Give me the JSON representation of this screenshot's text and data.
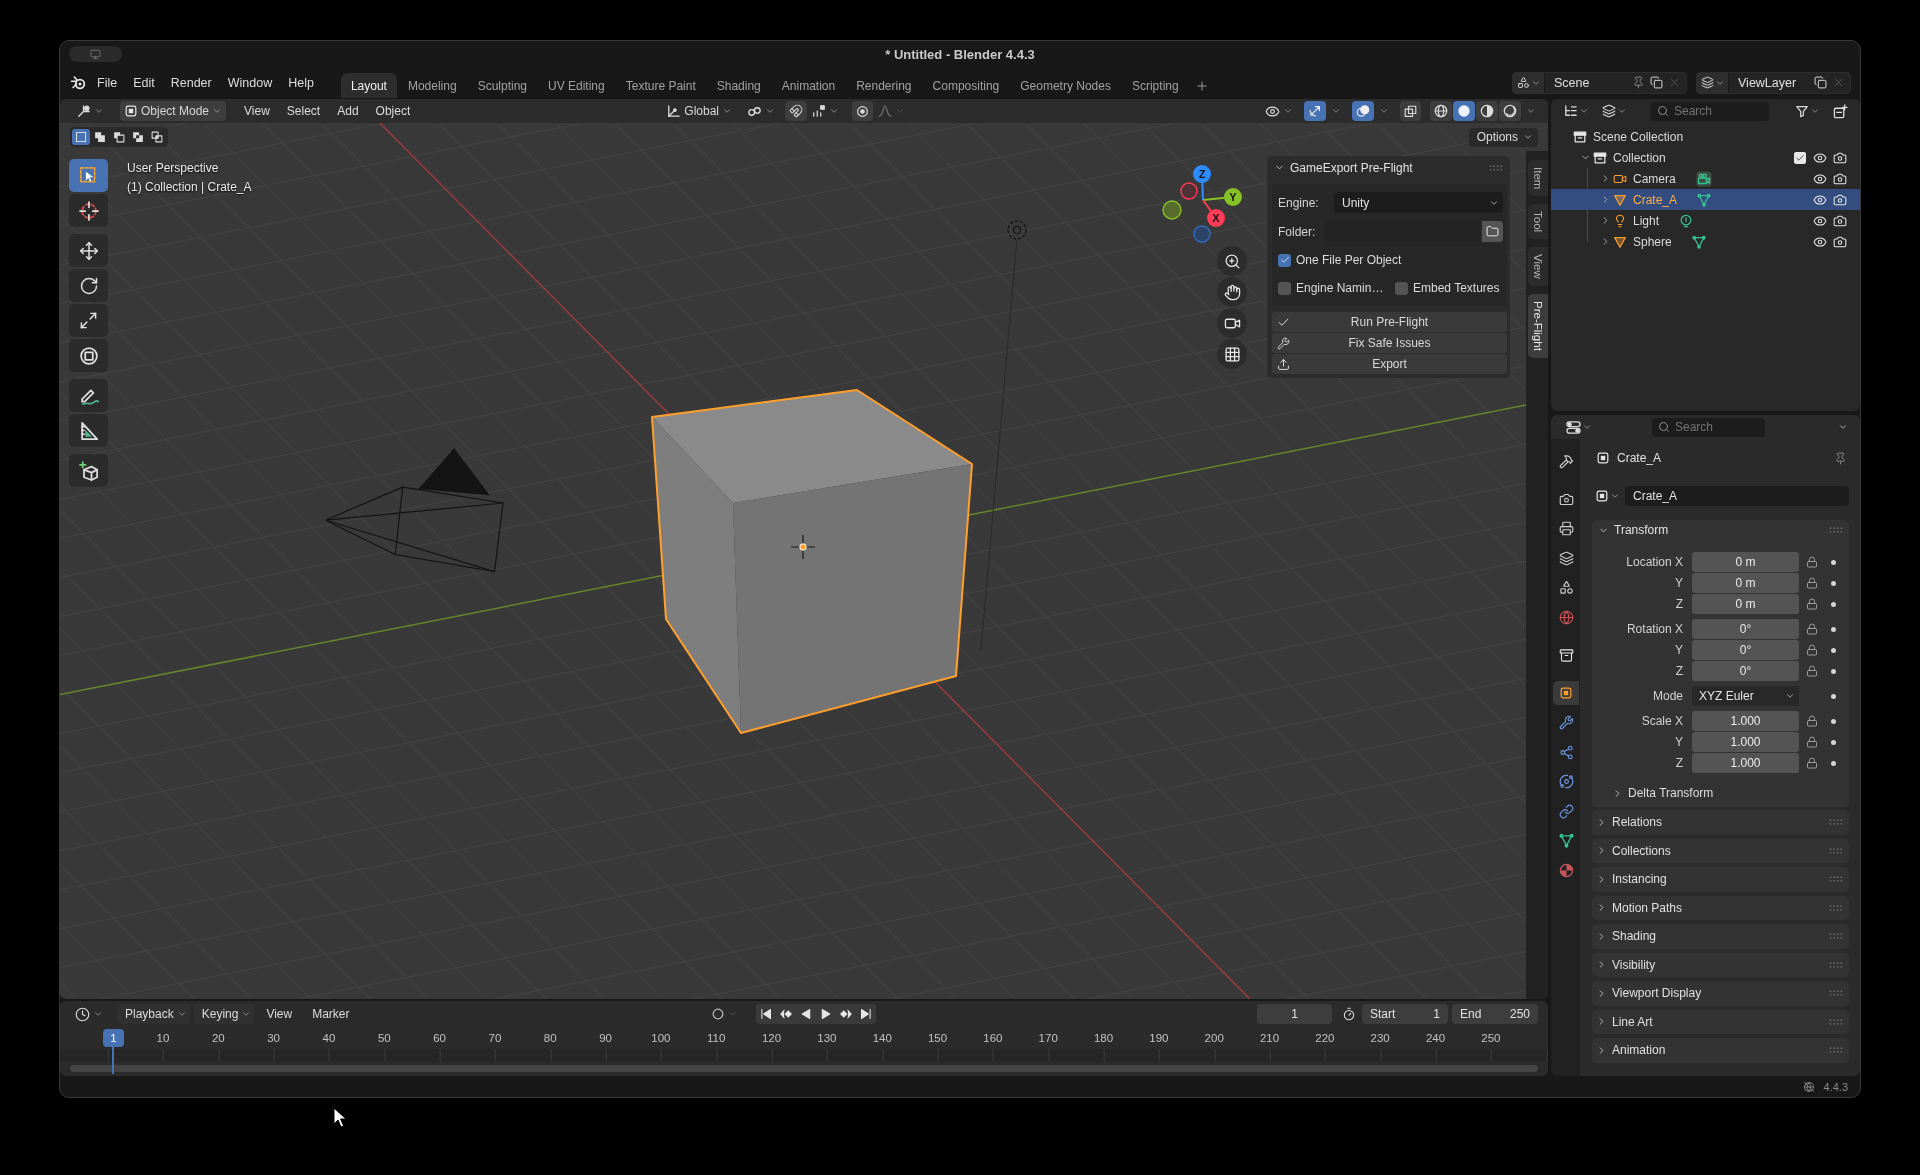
{
  "window": {
    "title": "* Untitled - Blender 4.4.3"
  },
  "menus": [
    "File",
    "Edit",
    "Render",
    "Window",
    "Help"
  ],
  "workspace_tabs": [
    {
      "label": "Layout",
      "selected": true
    },
    {
      "label": "Modeling",
      "selected": false
    },
    {
      "label": "Sculpting",
      "selected": false
    },
    {
      "label": "UV Editing",
      "selected": false
    },
    {
      "label": "Texture Paint",
      "selected": false
    },
    {
      "label": "Shading",
      "selected": false
    },
    {
      "label": "Animation",
      "selected": false
    },
    {
      "label": "Rendering",
      "selected": false
    },
    {
      "label": "Compositing",
      "selected": false
    },
    {
      "label": "Geometry Nodes",
      "selected": false
    },
    {
      "label": "Scripting",
      "selected": false
    }
  ],
  "scene_selector": {
    "value": "Scene"
  },
  "view_layer_selector": {
    "value": "ViewLayer"
  },
  "viewport": {
    "header": {
      "mode": "Object Mode",
      "menus": [
        "View",
        "Select",
        "Add",
        "Object"
      ],
      "orientation": "Global",
      "snap": {
        "on": false
      },
      "proportional_editing": {
        "on": false
      },
      "gizmos": {
        "on": true
      },
      "overlays": {
        "on": true
      },
      "xray": {
        "on": false
      },
      "shading": [
        {
          "kind": "wireframe",
          "selected": false
        },
        {
          "kind": "solid",
          "selected": true
        },
        {
          "kind": "material",
          "selected": false
        },
        {
          "kind": "rendered",
          "selected": false
        }
      ]
    },
    "select_modes": [
      {
        "kind": "set",
        "selected": true
      },
      {
        "kind": "extend",
        "selected": false
      },
      {
        "kind": "subtract",
        "selected": false
      },
      {
        "kind": "invert",
        "selected": false
      },
      {
        "kind": "intersect",
        "selected": false
      }
    ],
    "options": "Options",
    "tool_groups": [
      [
        {
          "kind": "select_box",
          "selected": true
        },
        {
          "kind": "cursor",
          "selected": false
        }
      ],
      [
        {
          "kind": "move",
          "selected": false
        },
        {
          "kind": "rotate",
          "selected": false
        },
        {
          "kind": "scale",
          "selected": false
        },
        {
          "kind": "transform",
          "selected": false
        }
      ],
      [
        {
          "kind": "annotate",
          "selected": false
        },
        {
          "kind": "measure",
          "selected": false
        }
      ],
      [
        {
          "kind": "add_cube",
          "selected": false
        }
      ]
    ],
    "info": [
      "User Perspective",
      "(1) Collection | Crate_A"
    ],
    "scene_objects": [
      {
        "kind": "camera",
        "selected": false
      },
      {
        "kind": "light",
        "selected": false
      },
      {
        "kind": "cube",
        "selected": true
      }
    ],
    "axes": [
      {
        "kind": "z",
        "label": "Z"
      },
      {
        "kind": "y",
        "label": "Y"
      },
      {
        "kind": "x",
        "label": "X"
      }
    ],
    "sidebar_panel": {
      "title": "GameExport Pre-Flight",
      "expanded": true,
      "engine": {
        "label": "Engine:",
        "value": "Unity"
      },
      "folder": {
        "label": "Folder:"
      },
      "checkbox_rows": [
        [
          {
            "label": "One File Per Object",
            "checked": true
          }
        ],
        [
          {
            "label": "Engine Namin…",
            "checked": false
          },
          {
            "label": "Embed Textures",
            "checked": false
          }
        ]
      ],
      "buttons": [
        {
          "kind": "check",
          "label": "Run Pre-Flight"
        },
        {
          "kind": "tools",
          "label": "Fix Safe Issues"
        },
        {
          "kind": "export",
          "label": "Export"
        }
      ]
    },
    "sidebar_tabs": [
      {
        "label": "Item",
        "selected": false
      },
      {
        "label": "Tool",
        "selected": false
      },
      {
        "label": "View",
        "selected": false
      },
      {
        "label": "Pre-Flight",
        "selected": true
      }
    ]
  },
  "outliner": {
    "search_placeholder": "Search",
    "tree": [
      {
        "label": "Scene Collection",
        "kind": "scene_collection",
        "selected": false,
        "children": [
          {
            "label": "Collection",
            "kind": "collection",
            "selected": false,
            "expanded": true,
            "checked": true,
            "children": [
              {
                "label": "Camera",
                "kind": "camera",
                "selected": false,
                "expanded": false
              },
              {
                "label": "Crate_A",
                "kind": "mesh",
                "selected": true,
                "expanded": false
              },
              {
                "label": "Light",
                "kind": "light",
                "selected": false,
                "expanded": false
              },
              {
                "label": "Sphere",
                "kind": "mesh",
                "selected": false,
                "expanded": false
              }
            ]
          }
        ]
      }
    ]
  },
  "properties": {
    "search_placeholder": "Search",
    "tabs": [
      [
        {
          "kind": "tool",
          "selected": false
        }
      ],
      [
        {
          "kind": "render",
          "selected": false
        },
        {
          "kind": "output",
          "selected": false
        },
        {
          "kind": "view_layer",
          "selected": false
        },
        {
          "kind": "scene",
          "selected": false
        },
        {
          "kind": "world",
          "selected": false
        }
      ],
      [
        {
          "kind": "collection",
          "selected": false
        }
      ],
      [
        {
          "kind": "object",
          "selected": true
        },
        {
          "kind": "modifiers",
          "selected": false
        },
        {
          "kind": "particles",
          "selected": false
        },
        {
          "kind": "physics",
          "selected": false
        },
        {
          "kind": "constraints",
          "selected": false
        },
        {
          "kind": "data",
          "selected": false
        },
        {
          "kind": "material",
          "selected": false
        }
      ]
    ],
    "object_name": "Crate_A",
    "name_field": "Crate_A",
    "transform": {
      "title": "Transform",
      "expanded": true,
      "groups": [
        {
          "kind": "number",
          "rows": [
            {
              "label": "Location X",
              "value": "0 m"
            },
            {
              "label": "Y",
              "value": "0 m"
            },
            {
              "label": "Z",
              "value": "0 m"
            }
          ]
        },
        {
          "kind": "number",
          "rows": [
            {
              "label": "Rotation X",
              "value": "0°"
            },
            {
              "label": "Y",
              "value": "0°"
            },
            {
              "label": "Z",
              "value": "0°"
            }
          ]
        },
        {
          "kind": "dropdown",
          "rows": [
            {
              "label": "Mode",
              "value": "XYZ Euler"
            }
          ]
        },
        {
          "kind": "number",
          "rows": [
            {
              "label": "Scale X",
              "value": "1.000"
            },
            {
              "label": "Y",
              "value": "1.000"
            },
            {
              "label": "Z",
              "value": "1.000"
            }
          ]
        }
      ],
      "subpanel": {
        "title": "Delta Transform",
        "expanded": false
      }
    },
    "panels": [
      {
        "title": "Relations",
        "expanded": false
      },
      {
        "title": "Collections",
        "expanded": false
      },
      {
        "title": "Instancing",
        "expanded": false
      },
      {
        "title": "Motion Paths",
        "expanded": false
      },
      {
        "title": "Shading",
        "expanded": false
      },
      {
        "title": "Visibility",
        "expanded": false
      },
      {
        "title": "Viewport Display",
        "expanded": false
      },
      {
        "title": "Line Art",
        "expanded": false
      },
      {
        "title": "Animation",
        "expanded": false
      }
    ]
  },
  "timeline": {
    "menus": [
      {
        "label": "Playback",
        "dropdown": true
      },
      {
        "label": "Keying",
        "dropdown": true
      },
      {
        "label": "View",
        "dropdown": false
      },
      {
        "label": "Marker",
        "dropdown": false
      }
    ],
    "auto_keying": {
      "on": false
    },
    "current_frame": "1",
    "start": {
      "label": "Start",
      "value": "1"
    },
    "end": {
      "label": "End",
      "value": "250"
    },
    "playhead": "1",
    "ticks": [
      "10",
      "20",
      "30",
      "40",
      "50",
      "60",
      "70",
      "80",
      "90",
      "100",
      "110",
      "120",
      "130",
      "140",
      "150",
      "160",
      "170",
      "180",
      "190",
      "200",
      "210",
      "220",
      "230",
      "240",
      "250"
    ]
  },
  "status_bar": {
    "version": "4.4.3"
  }
}
